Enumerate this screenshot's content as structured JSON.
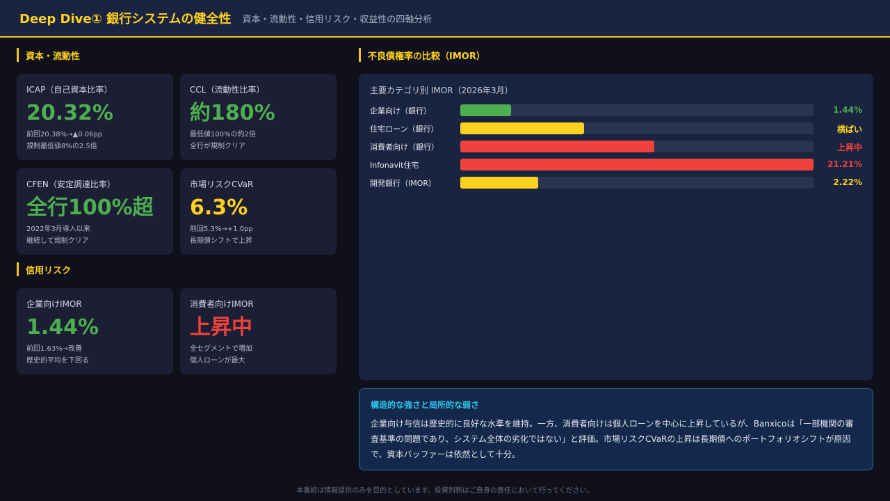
{
  "header": {
    "title": "Deep Dive① 銀行システムの健全性",
    "subtitle": "資本・流動性・信用リスク・収益性の四軸分析"
  },
  "sections": {
    "capital": "資本・流動性",
    "credit": "信用リスク",
    "chart": "不良債権率の比較（IMOR）"
  },
  "cards": {
    "icap": {
      "label": "ICAP（自己資本比率）",
      "value": "20.32%",
      "note1": "前回20.38%→▲0.06pp",
      "note2": "規制最低値8%の2.5倍",
      "color": "#4caf50"
    },
    "ccl": {
      "label": "CCL（流動性比率）",
      "value": "約180%",
      "note1": "最低値100%の約2倍",
      "note2": "全行が規制クリア",
      "color": "#4caf50"
    },
    "cfen": {
      "label": "CFEN（安定調達比率）",
      "value": "全行100%超",
      "note1": "2022年3月導入以来",
      "note2": "継続して規制クリア",
      "color": "#4caf50"
    },
    "cvar": {
      "label": "市場リスクCVaR",
      "value": "6.3%",
      "note1": "前回5.3%→+1.0pp",
      "note2": "長期債シフトで上昇",
      "color": "#ffd21f"
    },
    "corp_imor": {
      "label": "企業向けIMOR",
      "value": "1.44%",
      "note1": "前回1.63%→改善",
      "note2": "歴史的平均を下回る",
      "color": "#4caf50"
    },
    "cons_imor": {
      "label": "消費者向けIMOR",
      "value": "上昇中",
      "note1": "全セグメントで増加",
      "note2": "個人ローンが最大",
      "color": "#f0423c"
    }
  },
  "chart_data": {
    "type": "bar",
    "title": "主要カテゴリ別 IMOR（2026年3月）",
    "categories": [
      "企業向け（銀行）",
      "住宅ローン（銀行）",
      "消費者向け（銀行）",
      "Infonavit住宅",
      "開発銀行（IMOR）"
    ],
    "value_labels": [
      "1.44%",
      "横ばい",
      "上昇中",
      "21.21%",
      "2.22%"
    ],
    "fill_fraction": [
      0.143,
      0.35,
      0.55,
      1.0,
      0.22
    ],
    "colors": [
      "#4caf50",
      "#ffd21f",
      "#f0423c",
      "#f0423c",
      "#ffd21f"
    ]
  },
  "note": {
    "title": "構造的な強さと局所的な弱さ",
    "body": "企業向け与信は歴史的に良好な水準を維持。一方、消費者向けは個人ローンを中心に上昇しているが、Banxicoは「一部機関の審査基準の問題であり、システム全体の劣化ではない」と評価。市場リスクCVaRの上昇は長期債へのポートフォリオシフトが原因で、資本バッファーは依然として十分。"
  },
  "footer": "本番組は情報提供のみを目的としています。投資判断はご自身の責任において行ってください。"
}
